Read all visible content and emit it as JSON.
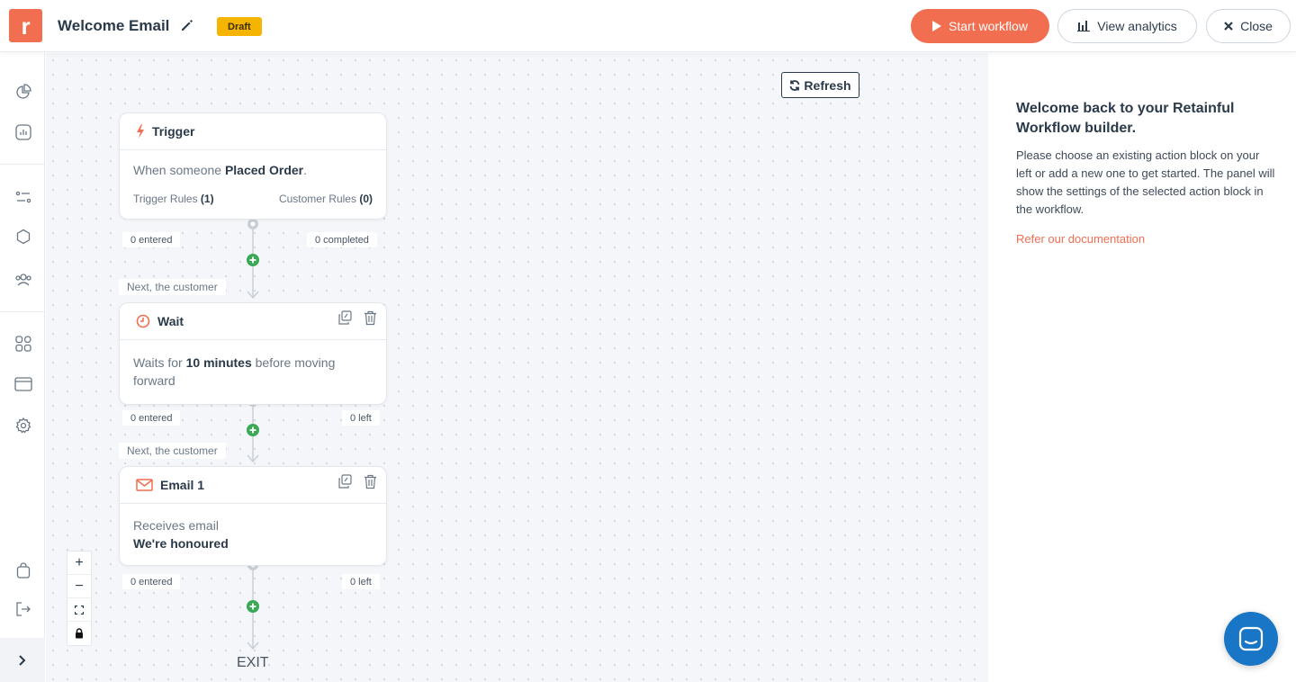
{
  "header": {
    "logo_letter": "r",
    "workflow_title": "Welcome Email",
    "status_badge": "Draft",
    "start_label": "Start workflow",
    "analytics_label": "View analytics",
    "close_label": "Close"
  },
  "canvas": {
    "refresh_label": "Refresh",
    "next_label": "Next, the customer",
    "exit_label": "EXIT",
    "trigger": {
      "title": "Trigger",
      "text_pre": "When someone ",
      "text_bold": "Placed Order",
      "text_post": ".",
      "trigger_rules_label": "Trigger Rules",
      "trigger_rules_count": "(1)",
      "customer_rules_label": "Customer Rules",
      "customer_rules_count": "(0)",
      "stat_left": "0 entered",
      "stat_right": "0 completed"
    },
    "wait": {
      "title": "Wait",
      "text_pre": "Waits for ",
      "text_bold": "10 minutes",
      "text_post": " before moving forward",
      "stat_left": "0 entered",
      "stat_right": "0 left"
    },
    "email": {
      "title": "Email 1",
      "text_line1": "Receives email",
      "text_bold": "We're honoured",
      "stat_left": "0 entered",
      "stat_right": "0 left"
    },
    "zoom": {
      "zoom_in": "+",
      "zoom_out": "−"
    }
  },
  "panel": {
    "title": "Welcome back to your Retainful Workflow builder.",
    "text": "Please choose an existing action block on your left or add a new one to get started. The panel will show the settings of the selected action block in the workflow.",
    "link": "Refer our documentation"
  },
  "colors": {
    "accent": "#f16e50",
    "draft_badge": "#f5b400",
    "add_node": "#3aa856",
    "chat_button": "#1976c6"
  }
}
